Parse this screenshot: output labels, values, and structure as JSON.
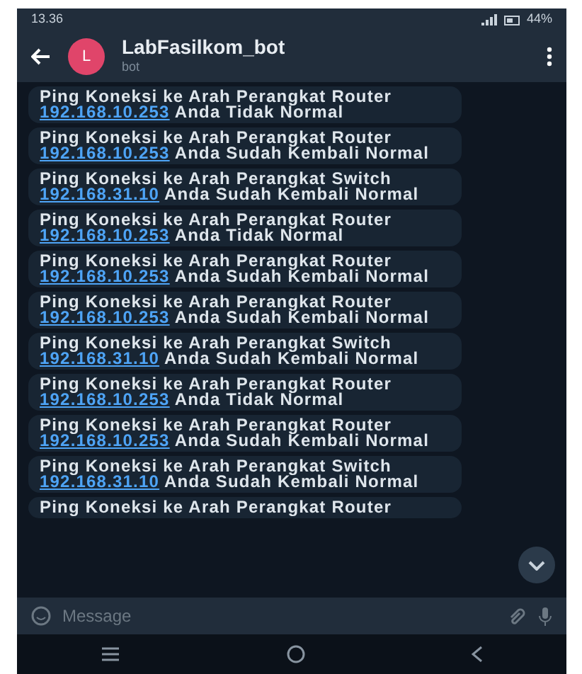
{
  "status_bar": {
    "time": "13.36",
    "battery": "44%"
  },
  "header": {
    "title": "LabFasilkom_bot",
    "subtitle": "bot",
    "avatar_letter": "L"
  },
  "messages": [
    {
      "text": "Ping Koneksi ke Arah Perangkat Router",
      "ip": "192.168.10.253",
      "result": "Anda Tidak Normal"
    },
    {
      "text": "Ping Koneksi ke Arah Perangkat Router",
      "ip": "192.168.10.253",
      "result": "Anda Sudah Kembali Normal"
    },
    {
      "text": "Ping Koneksi ke Arah Perangkat Switch",
      "ip": "192.168.31.10",
      "result": "Anda Sudah Kembali Normal"
    },
    {
      "text": "Ping Koneksi ke Arah Perangkat Router",
      "ip": "192.168.10.253",
      "result": "Anda Tidak Normal"
    },
    {
      "text": "Ping Koneksi ke Arah Perangkat Router",
      "ip": "192.168.10.253",
      "result": "Anda Sudah Kembali Normal"
    },
    {
      "text": "Ping Koneksi ke Arah Perangkat Router",
      "ip": "192.168.10.253",
      "result": "Anda Sudah Kembali Normal"
    },
    {
      "text": "Ping Koneksi ke Arah Perangkat Switch",
      "ip": "192.168.31.10",
      "result": "Anda Sudah Kembali Normal"
    },
    {
      "text": "Ping Koneksi ke Arah Perangkat Router",
      "ip": "192.168.10.253",
      "result": "Anda Tidak Normal"
    },
    {
      "text": "Ping Koneksi ke Arah Perangkat Router",
      "ip": "192.168.10.253",
      "result": "Anda Sudah Kembali Normal"
    },
    {
      "text": "Ping Koneksi ke Arah Perangkat Switch",
      "ip": "192.168.31.10",
      "result": "Anda Sudah Kembali Normal"
    },
    {
      "text": "Ping Koneksi ke Arah Perangkat Router"
    }
  ],
  "input": {
    "placeholder": "Message"
  }
}
